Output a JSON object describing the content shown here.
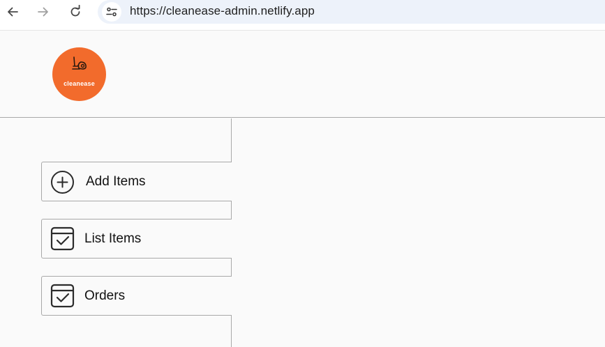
{
  "browser": {
    "url": "https://cleanease-admin.netlify.app",
    "icons": {
      "back": "arrow-left-icon",
      "forward": "arrow-right-icon",
      "reload": "reload-icon",
      "site_info": "tune-icon"
    }
  },
  "header": {
    "logo_text": "cleanease",
    "logo_color": "#f26b2c"
  },
  "sidebar": {
    "items": [
      {
        "label": "Add Items",
        "icon": "add-circle-icon"
      },
      {
        "label": "List Items",
        "icon": "calendar-check-icon"
      },
      {
        "label": "Orders",
        "icon": "calendar-check-icon"
      }
    ]
  }
}
